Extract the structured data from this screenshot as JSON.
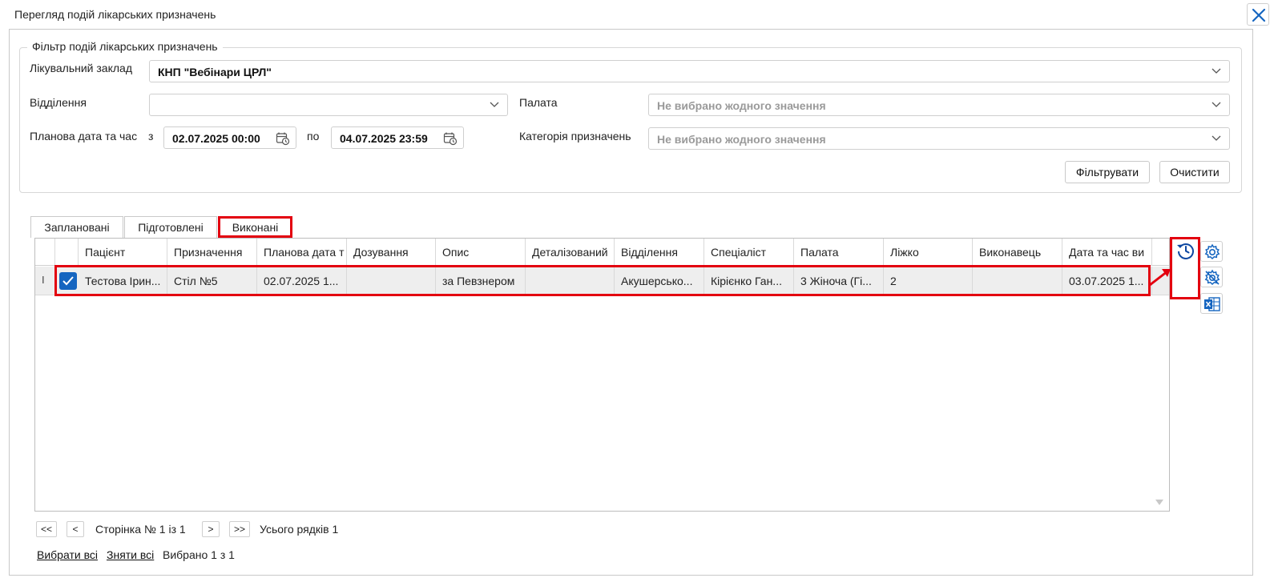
{
  "window": {
    "title": "Перегляд подій лікарських призначень"
  },
  "filter": {
    "legend": "Фільтр подій лікарських призначень",
    "facility_label": "Лікувальний заклад",
    "facility_value": "КНП \"Вебінари ЦРЛ\"",
    "department_label": "Відділення",
    "department_value": "",
    "ward_label": "Палата",
    "ward_value": "Не вибрано жодного значення",
    "date_label": "Планова дата та час",
    "from_label": "з",
    "from_value": "02.07.2025 00:00",
    "to_label": "по",
    "to_value": "04.07.2025 23:59",
    "category_label": "Категорія призначень",
    "category_value": "Не вибрано жодного значення",
    "filter_button": "Фільтрувати",
    "clear_button": "Очистити"
  },
  "tabs": [
    {
      "label": "Заплановані",
      "active": false
    },
    {
      "label": "Підготовлені",
      "active": false
    },
    {
      "label": "Виконані",
      "active": true
    }
  ],
  "grid": {
    "columns": [
      "Пацієнт",
      "Призначення",
      "Планова дата т",
      "Дозування",
      "Опис",
      "Деталізований",
      "Відділення",
      "Спеціаліст",
      "Палата",
      "Ліжко",
      "Виконавець",
      "Дата та час ви"
    ],
    "rows": [
      {
        "indicator": "I",
        "checked": true,
        "cells": [
          "Тестова Ірин...",
          "Стіл №5",
          "02.07.2025 1...",
          "",
          "за Певзнером",
          "",
          "Акушерсько...",
          "Кірієнко Ган...",
          "3 Жіноча (Гі...",
          "2",
          "",
          "03.07.2025 1..."
        ]
      }
    ]
  },
  "side_toolbar": {
    "icons": [
      "history-icon",
      "settings-icon",
      "column-settings-icon",
      "excel-export-icon"
    ]
  },
  "pager": {
    "first": "<<",
    "prev": "<",
    "page_text": "Сторінка № 1 із 1",
    "next": ">",
    "last": ">>",
    "total_text": "Усього рядків 1"
  },
  "selection": {
    "select_all": "Вибрати всі",
    "deselect_all": "Зняти всі",
    "selected_text": "Вибрано 1 з 1"
  },
  "colors": {
    "accent": "#1565c0",
    "highlight": "#e3000f"
  }
}
